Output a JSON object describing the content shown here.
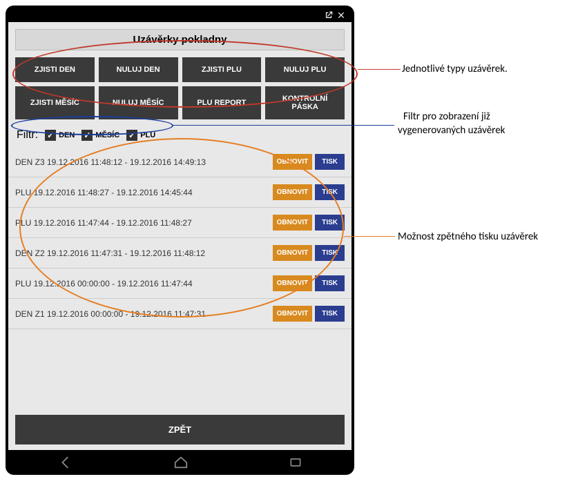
{
  "title": "Uzávěrky pokladny",
  "buttons": {
    "row1": [
      "ZJISTI DEN",
      "NULUJ DEN",
      "ZJISTI PLU",
      "NULUJ PLU"
    ],
    "row2": [
      "ZJISTI MĚSÍC",
      "NULUJ MĚSÍC",
      "PLU REPORT",
      "KONTROLNÍ PÁSKA"
    ]
  },
  "filter": {
    "label": "Filtr:",
    "items": [
      {
        "label": "DEN",
        "checked": true
      },
      {
        "label": "MĚSÍC",
        "checked": true
      },
      {
        "label": "PLU",
        "checked": true
      }
    ]
  },
  "rows": [
    {
      "text": "DEN Z3 19.12.2016 11:48:12 - 19.12.2016 14:49:13"
    },
    {
      "text": "PLU 19.12.2016 11:48:27 - 19.12.2016 14:45:44"
    },
    {
      "text": "PLU 19.12.2016 11:47:44 - 19.12.2016 11:48:27"
    },
    {
      "text": "DEN Z2 19.12.2016 11:47:31 - 19.12.2016 11:48:12"
    },
    {
      "text": "PLU 19.12.2016 00:00:00 - 19.12.2016 11:47:44"
    },
    {
      "text": "DEN Z1 19.12.2016 00:00:00 - 19.12.2016 11:47:31"
    }
  ],
  "rowButtons": {
    "obnovit": "OBNOVIT",
    "tisk": "TISK"
  },
  "backLabel": "ZPĚT",
  "annotations": {
    "types": "Jednotlivé typy uzávěrek.",
    "filter1": "Filtr pro zobrazení již",
    "filter2": "vygenerovaných uzávěrek",
    "reprint": "Možnost zpětného tisku uzávěrek"
  },
  "colors": {
    "red": "#c0392b",
    "blue": "#1a3d9c",
    "orange": "#e67e22"
  }
}
